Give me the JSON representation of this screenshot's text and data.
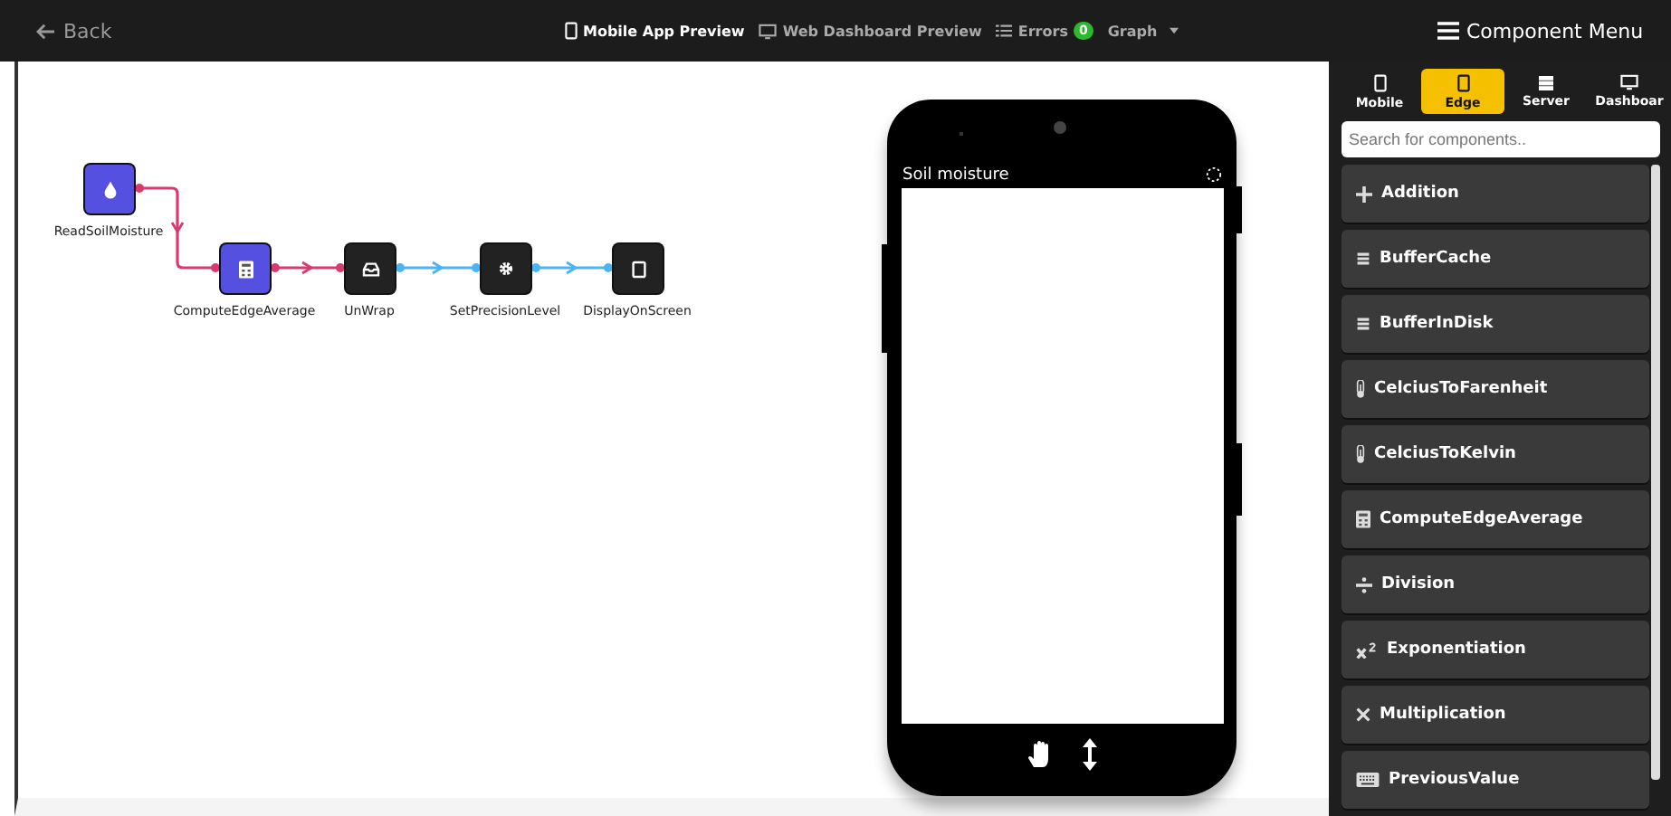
{
  "top_bar": {
    "back": "Back",
    "views": [
      {
        "label": "Mobile App Preview",
        "kind": "phone",
        "selected": true
      },
      {
        "label": "Web Dashboard Preview",
        "kind": "monitor",
        "selected": false
      }
    ],
    "errors": {
      "label": "Errors",
      "count": "0"
    },
    "graph": "Graph",
    "menu": "Component Menu"
  },
  "graph": {
    "nodes": [
      {
        "label": "ReadSoilMoisture",
        "kind": "drop",
        "color": "#5650e0"
      },
      {
        "label": "ComputeEdgeAverage",
        "kind": "calculator",
        "color": "#5650e0"
      },
      {
        "label": "UnWrap",
        "kind": "inbox",
        "color": "#222222"
      },
      {
        "label": "SetPrecisionLevel",
        "kind": "gear",
        "color": "#222222"
      },
      {
        "label": "DisplayOnScreen",
        "kind": "tablet",
        "color": "#222222"
      }
    ],
    "edges": [
      {
        "color": "#d83a6e"
      },
      {
        "color": "#d83a6e"
      },
      {
        "color": "#4ab4f4"
      },
      {
        "color": "#4ab4f4"
      }
    ]
  },
  "phone": {
    "title": "Soil moisture"
  },
  "component_menu": {
    "tabs": [
      {
        "label": "Mobile",
        "kind": "phone",
        "selected": false
      },
      {
        "label": "Edge",
        "kind": "phone",
        "selected": true
      },
      {
        "label": "Server",
        "kind": "server",
        "selected": false
      },
      {
        "label": "Dashboar",
        "kind": "monitor",
        "selected": false
      }
    ],
    "search": {
      "placeholder": "Search for components.."
    },
    "items": [
      {
        "label": "Addition",
        "kind": "plus"
      },
      {
        "label": "BufferCache",
        "kind": "stack"
      },
      {
        "label": "BufferInDisk",
        "kind": "stack"
      },
      {
        "label": "CelciusToFarenheit",
        "kind": "thermometer"
      },
      {
        "label": "CelciusToKelvin",
        "kind": "thermometer"
      },
      {
        "label": "ComputeEdgeAverage",
        "kind": "calculator"
      },
      {
        "label": "Division",
        "kind": "divide"
      },
      {
        "label": "Exponentiation",
        "kind": "power"
      },
      {
        "label": "Multiplication",
        "kind": "times"
      },
      {
        "label": "PreviousValue",
        "kind": "keyboard"
      }
    ]
  }
}
